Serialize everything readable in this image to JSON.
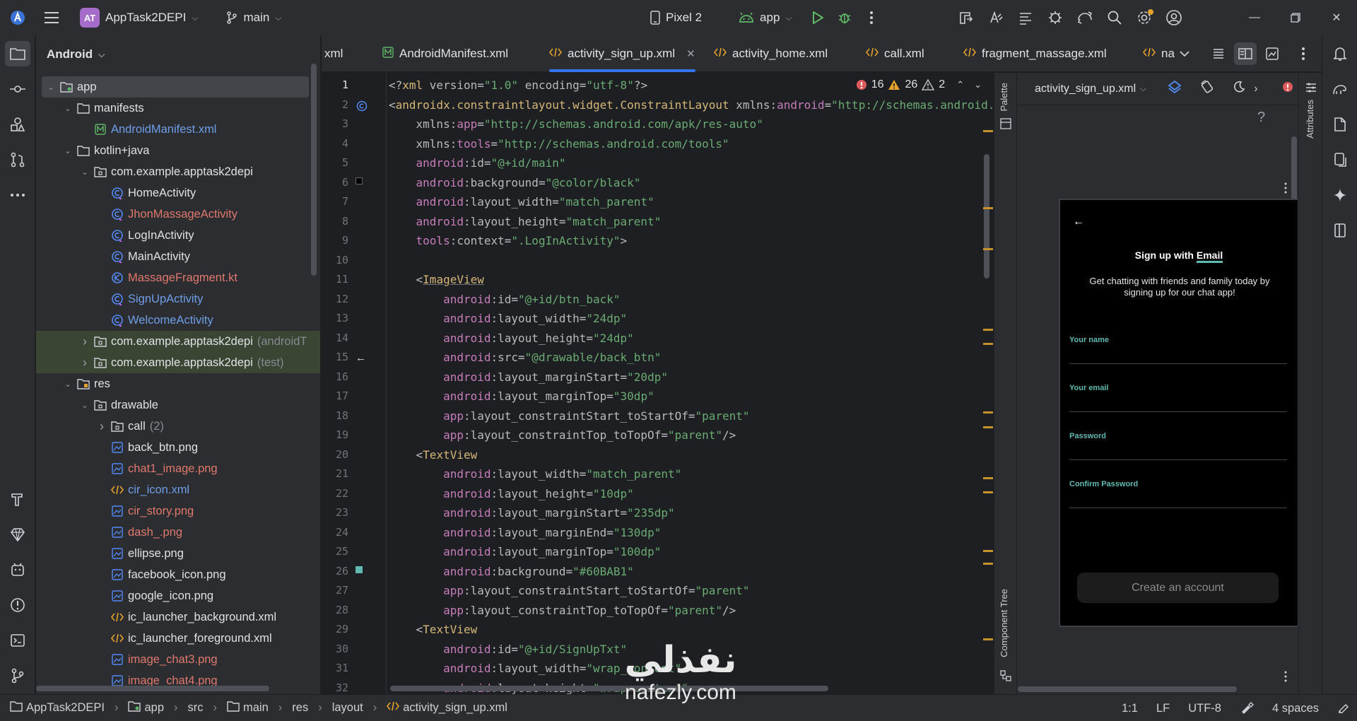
{
  "titlebar": {
    "project_badge": "AT",
    "project_name": "AppTask2DEPI",
    "branch": "main",
    "device": "Pixel 2",
    "run_config": "app"
  },
  "project_panel": {
    "title": "Android",
    "items": [
      {
        "label": "app",
        "suffix": "",
        "level": 0,
        "arrow": "down",
        "icon": "module-folder",
        "color": "norm",
        "state": "sel"
      },
      {
        "label": "manifests",
        "suffix": "",
        "level": 1,
        "arrow": "down",
        "icon": "folder",
        "color": "norm",
        "state": ""
      },
      {
        "label": "AndroidManifest.xml",
        "suffix": "",
        "level": 2,
        "arrow": "",
        "icon": "manifest",
        "color": "blue",
        "state": ""
      },
      {
        "label": "kotlin+java",
        "suffix": "",
        "level": 1,
        "arrow": "down",
        "icon": "folder",
        "color": "norm",
        "state": ""
      },
      {
        "label": "com.example.apptask2depi",
        "suffix": "",
        "level": 2,
        "arrow": "down",
        "icon": "package",
        "color": "norm",
        "state": ""
      },
      {
        "label": "HomeActivity",
        "suffix": "",
        "level": 3,
        "arrow": "",
        "icon": "kotlin-class",
        "color": "norm",
        "state": ""
      },
      {
        "label": "JhonMassageActivity",
        "suffix": "",
        "level": 3,
        "arrow": "",
        "icon": "kotlin-class",
        "color": "red",
        "state": ""
      },
      {
        "label": "LogInActivity",
        "suffix": "",
        "level": 3,
        "arrow": "",
        "icon": "kotlin-class",
        "color": "norm",
        "state": ""
      },
      {
        "label": "MainActivity",
        "suffix": "",
        "level": 3,
        "arrow": "",
        "icon": "kotlin-class",
        "color": "norm",
        "state": ""
      },
      {
        "label": "MassageFragment.kt",
        "suffix": "",
        "level": 3,
        "arrow": "",
        "icon": "kotlin-file",
        "color": "red",
        "state": ""
      },
      {
        "label": "SignUpActivity",
        "suffix": "",
        "level": 3,
        "arrow": "",
        "icon": "kotlin-class",
        "color": "blue",
        "state": ""
      },
      {
        "label": "WelcomeActivity",
        "suffix": "",
        "level": 3,
        "arrow": "",
        "icon": "kotlin-class",
        "color": "blue",
        "state": ""
      },
      {
        "label": "com.example.apptask2depi",
        "suffix": "(androidT",
        "level": 2,
        "arrow": "right",
        "icon": "package",
        "color": "norm",
        "state": "hl"
      },
      {
        "label": "com.example.apptask2depi",
        "suffix": "(test)",
        "level": 2,
        "arrow": "right",
        "icon": "package",
        "color": "norm",
        "state": "hl"
      },
      {
        "label": "res",
        "suffix": "",
        "level": 1,
        "arrow": "down",
        "icon": "res-folder",
        "color": "norm",
        "state": ""
      },
      {
        "label": "drawable",
        "suffix": "",
        "level": 2,
        "arrow": "down",
        "icon": "package",
        "color": "norm",
        "state": ""
      },
      {
        "label": "call",
        "suffix": "(2)",
        "level": 3,
        "arrow": "right",
        "icon": "package",
        "color": "norm",
        "state": ""
      },
      {
        "label": "back_btn.png",
        "suffix": "",
        "level": 3,
        "arrow": "",
        "icon": "image",
        "color": "norm",
        "state": ""
      },
      {
        "label": "chat1_image.png",
        "suffix": "",
        "level": 3,
        "arrow": "",
        "icon": "image",
        "color": "red",
        "state": ""
      },
      {
        "label": "cir_icon.xml",
        "suffix": "",
        "level": 3,
        "arrow": "",
        "icon": "xml",
        "color": "blue",
        "state": ""
      },
      {
        "label": "cir_story.png",
        "suffix": "",
        "level": 3,
        "arrow": "",
        "icon": "image",
        "color": "red",
        "state": ""
      },
      {
        "label": "dash_.png",
        "suffix": "",
        "level": 3,
        "arrow": "",
        "icon": "image",
        "color": "red",
        "state": ""
      },
      {
        "label": "ellipse.png",
        "suffix": "",
        "level": 3,
        "arrow": "",
        "icon": "image",
        "color": "norm",
        "state": ""
      },
      {
        "label": "facebook_icon.png",
        "suffix": "",
        "level": 3,
        "arrow": "",
        "icon": "image",
        "color": "norm",
        "state": ""
      },
      {
        "label": "google_icon.png",
        "suffix": "",
        "level": 3,
        "arrow": "",
        "icon": "image",
        "color": "norm",
        "state": ""
      },
      {
        "label": "ic_launcher_background.xml",
        "suffix": "",
        "level": 3,
        "arrow": "",
        "icon": "xml",
        "color": "norm",
        "state": ""
      },
      {
        "label": "ic_launcher_foreground.xml",
        "suffix": "",
        "level": 3,
        "arrow": "",
        "icon": "xml",
        "color": "norm",
        "state": ""
      },
      {
        "label": "image_chat3.png",
        "suffix": "",
        "level": 3,
        "arrow": "",
        "icon": "image",
        "color": "red",
        "state": ""
      },
      {
        "label": "image_chat4.png",
        "suffix": "",
        "level": 3,
        "arrow": "",
        "icon": "image",
        "color": "red",
        "state": ""
      }
    ]
  },
  "tabs": [
    {
      "label": "xml",
      "icon": "",
      "active": false,
      "closable": false
    },
    {
      "label": "AndroidManifest.xml",
      "icon": "manifest",
      "active": false,
      "closable": false
    },
    {
      "label": "activity_sign_up.xml",
      "icon": "xml",
      "active": true,
      "closable": true
    },
    {
      "label": "activity_home.xml",
      "icon": "xml",
      "active": false,
      "closable": false
    },
    {
      "label": "call.xml",
      "icon": "xml",
      "active": false,
      "closable": false
    },
    {
      "label": "fragment_massage.xml",
      "icon": "xml",
      "active": false,
      "closable": false
    },
    {
      "label": "na",
      "icon": "xml",
      "active": false,
      "closable": false
    }
  ],
  "inspections": {
    "errors": "16",
    "warnings": "26",
    "weak_warnings": "2"
  },
  "editor": {
    "lines": [
      [
        [
          "t-dim",
          "<?"
        ],
        [
          "t-tag",
          "xml "
        ],
        [
          "t-attr",
          "version"
        ],
        [
          "t-dim",
          "="
        ],
        [
          "t-val",
          "\"1.0\""
        ],
        [
          "t-dim",
          " "
        ],
        [
          "t-attr",
          "encoding"
        ],
        [
          "t-dim",
          "="
        ],
        [
          "t-val",
          "\"utf-8\""
        ],
        [
          "t-dim",
          "?>"
        ]
      ],
      [
        [
          "t-dim",
          "<"
        ],
        [
          "t-tag",
          "androidx.constraintlayout.widget.ConstraintLayout "
        ],
        [
          "t-attr",
          "xmlns:"
        ],
        [
          "t-ns",
          "android"
        ],
        [
          "t-dim",
          "="
        ],
        [
          "t-val",
          "\"http://schemas.android.com/apk/res/android\""
        ]
      ],
      [
        [
          "t-dim",
          "    "
        ],
        [
          "t-attr",
          "xmlns:"
        ],
        [
          "t-ns",
          "app"
        ],
        [
          "t-dim",
          "="
        ],
        [
          "t-val",
          "\"http://schemas.android.com/apk/res-auto\""
        ]
      ],
      [
        [
          "t-dim",
          "    "
        ],
        [
          "t-attr",
          "xmlns:"
        ],
        [
          "t-ns",
          "tools"
        ],
        [
          "t-dim",
          "="
        ],
        [
          "t-val",
          "\"http://schemas.android.com/tools\""
        ]
      ],
      [
        [
          "t-dim",
          "    "
        ],
        [
          "t-ns",
          "android"
        ],
        [
          "t-attr",
          ":id"
        ],
        [
          "t-dim",
          "="
        ],
        [
          "t-val",
          "\"@+id/main\""
        ]
      ],
      [
        [
          "t-dim",
          "    "
        ],
        [
          "t-ns",
          "android"
        ],
        [
          "t-attr",
          ":background"
        ],
        [
          "t-dim",
          "="
        ],
        [
          "t-val",
          "\"@color/black\""
        ]
      ],
      [
        [
          "t-dim",
          "    "
        ],
        [
          "t-ns",
          "android"
        ],
        [
          "t-attr",
          ":layout_width"
        ],
        [
          "t-dim",
          "="
        ],
        [
          "t-val",
          "\"match_parent\""
        ]
      ],
      [
        [
          "t-dim",
          "    "
        ],
        [
          "t-ns",
          "android"
        ],
        [
          "t-attr",
          ":layout_height"
        ],
        [
          "t-dim",
          "="
        ],
        [
          "t-val",
          "\"match_parent\""
        ]
      ],
      [
        [
          "t-dim",
          "    "
        ],
        [
          "t-ns",
          "tools"
        ],
        [
          "t-attr",
          ":context"
        ],
        [
          "t-dim",
          "="
        ],
        [
          "t-val",
          "\".LogInActivity\""
        ],
        [
          "t-dim",
          ">"
        ]
      ],
      [],
      [
        [
          "t-dim",
          "    <"
        ],
        [
          "t-tag t-und",
          "ImageView"
        ]
      ],
      [
        [
          "t-dim",
          "        "
        ],
        [
          "t-ns",
          "android"
        ],
        [
          "t-attr",
          ":id"
        ],
        [
          "t-dim",
          "="
        ],
        [
          "t-val",
          "\"@+id/btn_back\""
        ]
      ],
      [
        [
          "t-dim",
          "        "
        ],
        [
          "t-ns",
          "android"
        ],
        [
          "t-attr",
          ":layout_width"
        ],
        [
          "t-dim",
          "="
        ],
        [
          "t-val",
          "\"24dp\""
        ]
      ],
      [
        [
          "t-dim",
          "        "
        ],
        [
          "t-ns",
          "android"
        ],
        [
          "t-attr",
          ":layout_height"
        ],
        [
          "t-dim",
          "="
        ],
        [
          "t-val",
          "\"24dp\""
        ]
      ],
      [
        [
          "t-dim",
          "        "
        ],
        [
          "t-ns",
          "android"
        ],
        [
          "t-attr",
          ":src"
        ],
        [
          "t-dim",
          "="
        ],
        [
          "t-val",
          "\"@drawable/back_btn\""
        ]
      ],
      [
        [
          "t-dim",
          "        "
        ],
        [
          "t-ns",
          "android"
        ],
        [
          "t-attr",
          ":layout_marginStart"
        ],
        [
          "t-dim",
          "="
        ],
        [
          "t-val",
          "\"20dp\""
        ]
      ],
      [
        [
          "t-dim",
          "        "
        ],
        [
          "t-ns",
          "android"
        ],
        [
          "t-attr",
          ":layout_marginTop"
        ],
        [
          "t-dim",
          "="
        ],
        [
          "t-val",
          "\"30dp\""
        ]
      ],
      [
        [
          "t-dim",
          "        "
        ],
        [
          "t-ns",
          "app"
        ],
        [
          "t-attr",
          ":layout_constraintStart_toStartOf"
        ],
        [
          "t-dim",
          "="
        ],
        [
          "t-val",
          "\"parent\""
        ]
      ],
      [
        [
          "t-dim",
          "        "
        ],
        [
          "t-ns",
          "app"
        ],
        [
          "t-attr",
          ":layout_constraintTop_toTopOf"
        ],
        [
          "t-dim",
          "="
        ],
        [
          "t-val",
          "\"parent\""
        ],
        [
          "t-dim",
          "/>"
        ]
      ],
      [
        [
          "t-dim",
          "    <"
        ],
        [
          "t-tag",
          "TextView"
        ]
      ],
      [
        [
          "t-dim",
          "        "
        ],
        [
          "t-ns",
          "android"
        ],
        [
          "t-attr",
          ":layout_width"
        ],
        [
          "t-dim",
          "="
        ],
        [
          "t-val",
          "\"match_parent\""
        ]
      ],
      [
        [
          "t-dim",
          "        "
        ],
        [
          "t-ns",
          "android"
        ],
        [
          "t-attr",
          ":layout_height"
        ],
        [
          "t-dim",
          "="
        ],
        [
          "t-val",
          "\"10dp\""
        ]
      ],
      [
        [
          "t-dim",
          "        "
        ],
        [
          "t-ns",
          "android"
        ],
        [
          "t-attr",
          ":layout_marginStart"
        ],
        [
          "t-dim",
          "="
        ],
        [
          "t-val",
          "\"235dp\""
        ]
      ],
      [
        [
          "t-dim",
          "        "
        ],
        [
          "t-ns",
          "android"
        ],
        [
          "t-attr",
          ":layout_marginEnd"
        ],
        [
          "t-dim",
          "="
        ],
        [
          "t-val",
          "\"130dp\""
        ]
      ],
      [
        [
          "t-dim",
          "        "
        ],
        [
          "t-ns",
          "android"
        ],
        [
          "t-attr",
          ":layout_marginTop"
        ],
        [
          "t-dim",
          "="
        ],
        [
          "t-val",
          "\"100dp\""
        ]
      ],
      [
        [
          "t-dim",
          "        "
        ],
        [
          "t-ns",
          "android"
        ],
        [
          "t-attr",
          ":background"
        ],
        [
          "t-dim",
          "="
        ],
        [
          "t-val",
          "\"#60BAB1\""
        ]
      ],
      [
        [
          "t-dim",
          "        "
        ],
        [
          "t-ns",
          "app"
        ],
        [
          "t-attr",
          ":layout_constraintStart_toStartOf"
        ],
        [
          "t-dim",
          "="
        ],
        [
          "t-val",
          "\"parent\""
        ]
      ],
      [
        [
          "t-dim",
          "        "
        ],
        [
          "t-ns",
          "app"
        ],
        [
          "t-attr",
          ":layout_constraintTop_toTopOf"
        ],
        [
          "t-dim",
          "="
        ],
        [
          "t-val",
          "\"parent\""
        ],
        [
          "t-dim",
          "/>"
        ]
      ],
      [
        [
          "t-dim",
          "    <"
        ],
        [
          "t-tag",
          "TextView"
        ]
      ],
      [
        [
          "t-dim",
          "        "
        ],
        [
          "t-ns",
          "android"
        ],
        [
          "t-attr",
          ":id"
        ],
        [
          "t-dim",
          "="
        ],
        [
          "t-val",
          "\"@+id/SignUpTxt\""
        ]
      ],
      [
        [
          "t-dim",
          "        "
        ],
        [
          "t-ns",
          "android"
        ],
        [
          "t-attr",
          ":layout_width"
        ],
        [
          "t-dim",
          "="
        ],
        [
          "t-val",
          "\"wrap_content\""
        ]
      ],
      [
        [
          "t-dim",
          "        "
        ],
        [
          "t-ns",
          "android"
        ],
        [
          "t-attr",
          ":layout_height"
        ],
        [
          "t-dim",
          "="
        ],
        [
          "t-val",
          "\"wrap_content\""
        ]
      ]
    ]
  },
  "design": {
    "file": "activity_sign_up.xml",
    "palette_label": "Palette",
    "component_tree_label": "Component Tree",
    "attributes_label": "Attributes",
    "help": "?"
  },
  "phone": {
    "back": "←",
    "title_a": "Sign up with ",
    "title_b": "Email",
    "subtitle": "Get chatting with friends and family today by signing up for our chat app!",
    "fields": [
      "Your name",
      "Your email",
      "Password",
      "Confirm Password"
    ],
    "button": "Create an account",
    "accent": "#60BAB1"
  },
  "statusbar": {
    "crumbs": [
      "AppTask2DEPI",
      "app",
      "src",
      "main",
      "res",
      "layout",
      "activity_sign_up.xml"
    ],
    "position": "1:1",
    "line_sep": "LF",
    "encoding": "UTF-8",
    "indent": "4 spaces"
  },
  "watermark": {
    "arabic": "نفذلي",
    "domain": "nafezly.com"
  }
}
